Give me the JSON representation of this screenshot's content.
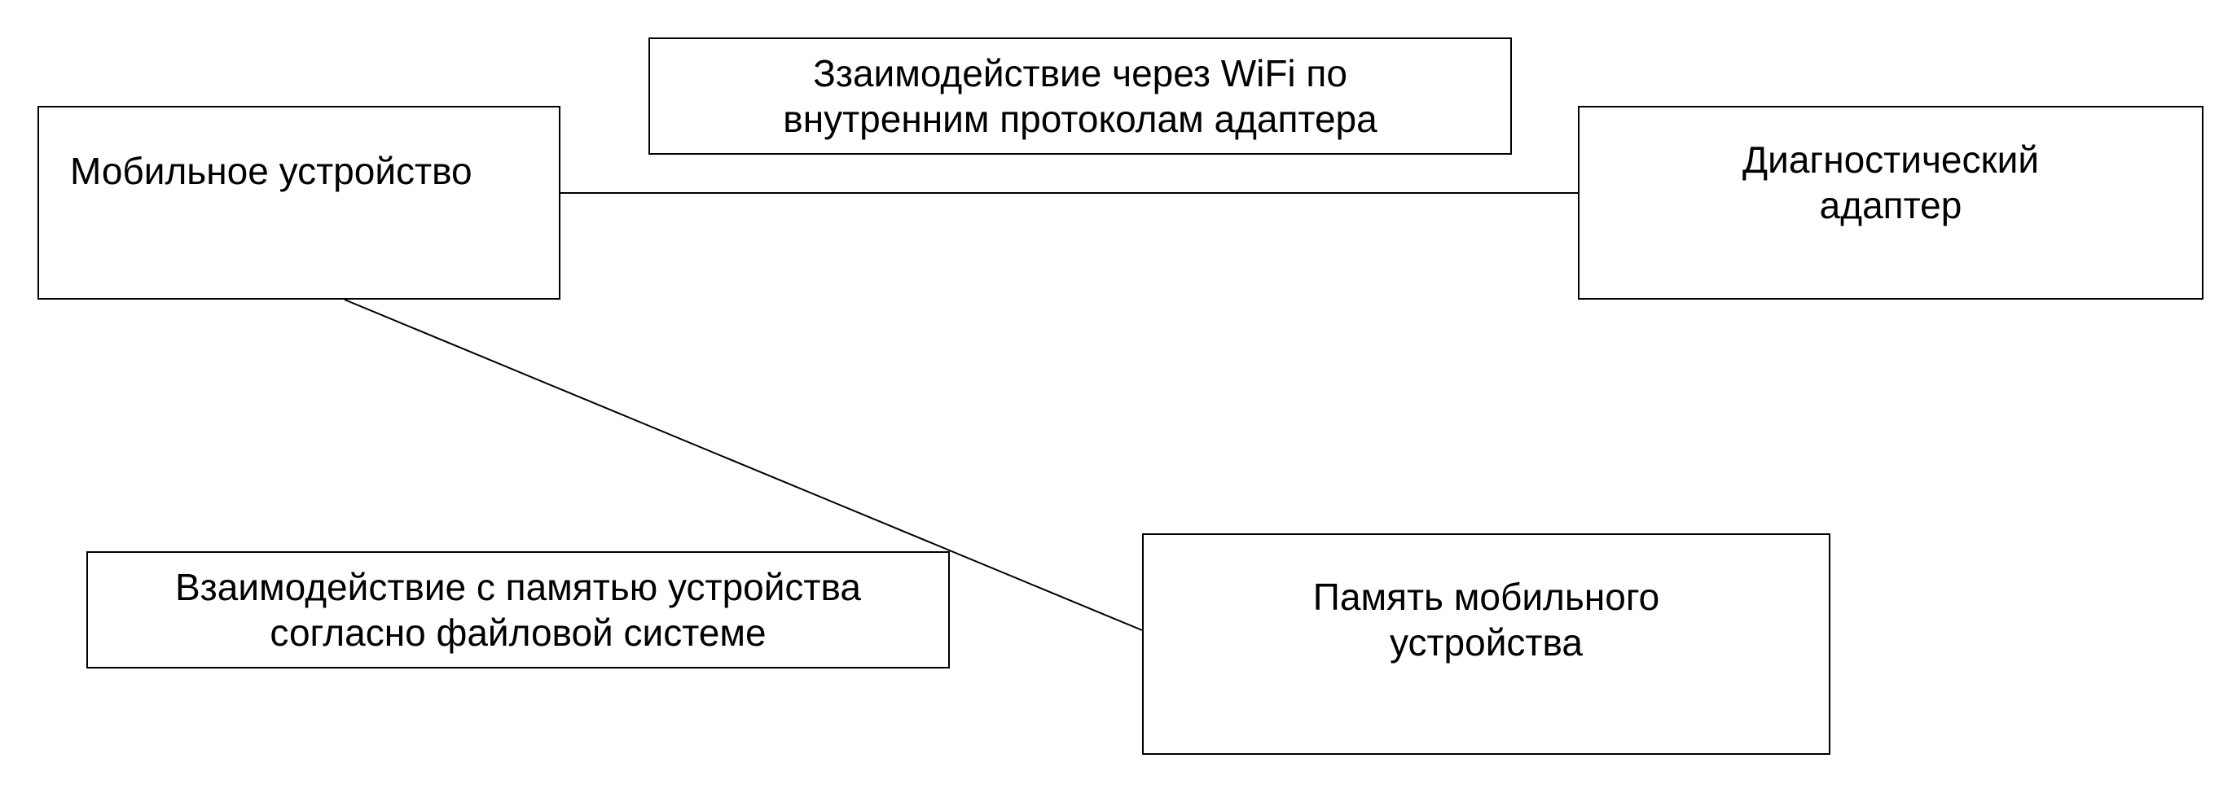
{
  "diagram": {
    "nodes": {
      "mobile_device": {
        "label": "Мобильное устройство"
      },
      "diagnostic_adapter": {
        "label_lines": [
          "Диагностический",
          "адаптер"
        ]
      },
      "device_memory": {
        "label_lines": [
          "Память мобильного",
          "устройства"
        ]
      }
    },
    "annotations": {
      "wifi": {
        "label_lines": [
          "Ззаимодействие через WiFi по",
          "внутренним протоколам адаптера"
        ]
      },
      "file_system": {
        "label_lines": [
          "Взаимодействие с памятью устройства",
          "согласно файловой системе"
        ]
      }
    },
    "edges": [
      {
        "from": "mobile_device",
        "to": "diagnostic_adapter"
      },
      {
        "from": "mobile_device",
        "to": "device_memory"
      }
    ],
    "colors": {
      "stroke": "#000000",
      "background": "#ffffff"
    }
  }
}
